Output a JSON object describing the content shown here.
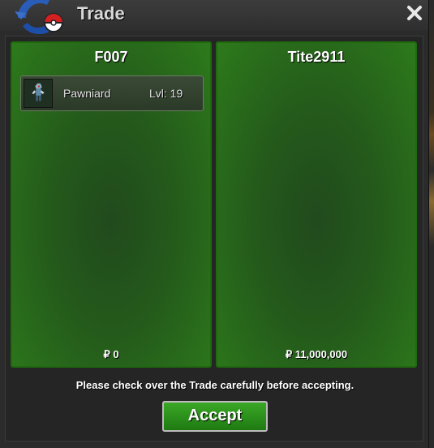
{
  "window": {
    "title": "Trade",
    "close_icon": "close-icon",
    "logo_icon": "pokeball-swirl-logo"
  },
  "players": [
    {
      "name": "F007",
      "items": [
        {
          "name": "Pawniard",
          "level": "Lvl: 19",
          "icon": "pawniard-sprite-icon"
        }
      ],
      "money": "₽ 0"
    },
    {
      "name": "Tite2911",
      "items": [],
      "money": "₽ 11,000,000"
    }
  ],
  "notice": "Please check over the Trade carefully before accepting.",
  "accept_label": "Accept",
  "colors": {
    "panel_green": "#245a1b",
    "panel_border": "#1f6a0f",
    "accept_green": "#2a9a1c",
    "window_bg": "#2b2b2b"
  }
}
